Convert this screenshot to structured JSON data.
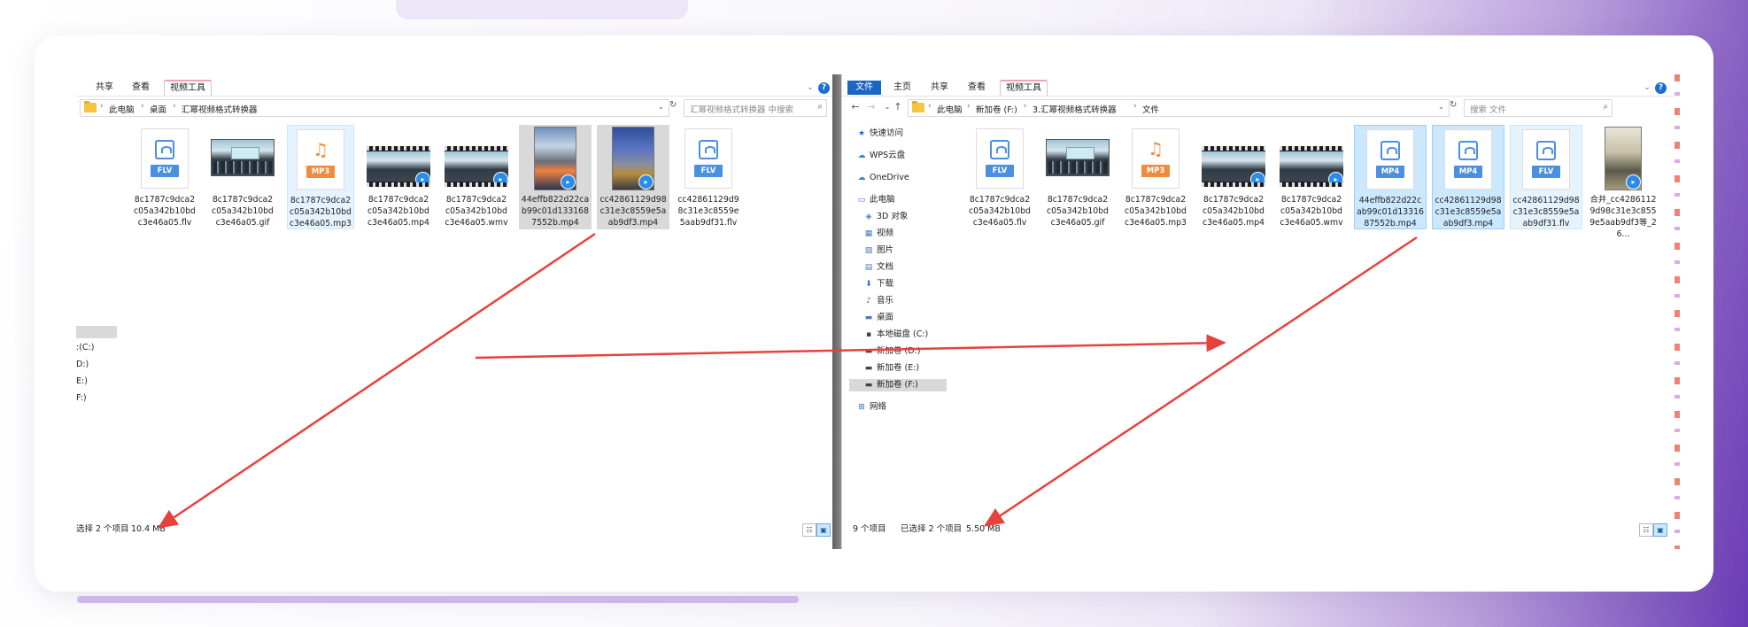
{
  "left_window": {
    "ribbon": {
      "tabs": [
        "共享",
        "查看",
        "视频工具"
      ]
    },
    "breadcrumb": [
      "此电脑",
      "桌面",
      "汇幂视频格式转换器"
    ],
    "search_placeholder": "汇幂视频格式转换器 中搜索",
    "files": [
      {
        "name": "8c1787c9dca2c05a342b10bdc3e46a05.flv",
        "kind": "FLV",
        "state": "normal"
      },
      {
        "name": "8c1787c9dca2c05a342b10bdc3e46a05.gif",
        "kind": "photo",
        "state": "normal"
      },
      {
        "name": "8c1787c9dca2c05a342b10bdc3e46a05.mp3",
        "kind": "MP3",
        "state": "focused"
      },
      {
        "name": "8c1787c9dca2c05a342b10bdc3e46a05.mp4",
        "kind": "film",
        "state": "normal"
      },
      {
        "name": "8c1787c9dca2c05a342b10bdc3e46a05.wmv",
        "kind": "film",
        "state": "normal"
      },
      {
        "name": "44effb822d22cab99c01d1331687552b.mp4",
        "kind": "vertical-a",
        "state": "highlighted"
      },
      {
        "name": "cc42861129d98c31e3c8559e5aab9df3.mp4",
        "kind": "vertical-b",
        "state": "highlighted"
      },
      {
        "name": "cc42861129d98c31e3c8559e5aab9df31.flv",
        "kind": "FLV",
        "state": "normal"
      }
    ],
    "nav_partial": [
      ":(C:)",
      "D:)",
      "E:)",
      "F:)"
    ],
    "status": {
      "selected": "选择 2 个项目",
      "size": "10.4 MB"
    }
  },
  "right_window": {
    "ribbon": {
      "tabs": [
        "文件",
        "主页",
        "共享",
        "查看",
        "视频工具"
      ]
    },
    "breadcrumb": [
      "此电脑",
      "新加卷 (F:)",
      "3.汇幂视频格式转换器",
      "文件"
    ],
    "search_placeholder": "搜索 文件",
    "nav": {
      "quick_access": "快速访问",
      "wps": "WPS云盘",
      "onedrive": "OneDrive",
      "this_pc": "此电脑",
      "items": [
        "3D 对象",
        "视频",
        "图片",
        "文档",
        "下载",
        "音乐",
        "桌面"
      ],
      "drives": [
        "本地磁盘 (C:)",
        "新加卷 (D:)",
        "新加卷 (E:)",
        "新加卷 (F:)"
      ],
      "network": "网络"
    },
    "files": [
      {
        "name": "8c1787c9dca2c05a342b10bdc3e46a05.flv",
        "kind": "FLV",
        "state": "normal"
      },
      {
        "name": "8c1787c9dca2c05a342b10bdc3e46a05.gif",
        "kind": "photo",
        "state": "normal"
      },
      {
        "name": "8c1787c9dca2c05a342b10bdc3e46a05.mp3",
        "kind": "MP3",
        "state": "normal"
      },
      {
        "name": "8c1787c9dca2c05a342b10bdc3e46a05.mp4",
        "kind": "film",
        "state": "normal"
      },
      {
        "name": "8c1787c9dca2c05a342b10bdc3e46a05.wmv",
        "kind": "film",
        "state": "normal"
      },
      {
        "name": "44effb822d22cab99c01d1331687552b.mp4",
        "kind": "MP4",
        "state": "selected"
      },
      {
        "name": "cc42861129d98c31e3c8559e5aab9df3.mp4",
        "kind": "MP4",
        "state": "selected"
      },
      {
        "name": "cc42861129d98c31e3c8559e5aab9df31.flv",
        "kind": "FLV",
        "state": "focused"
      },
      {
        "name": "合并_cc42861129d98c31e3c8559e5aab9df3等_26...",
        "kind": "vertical-c",
        "state": "normal"
      }
    ],
    "status": {
      "count": "9 个项目",
      "selected": "已选择 2 个项目",
      "size": "5.50 MB"
    }
  },
  "icons": {
    "video_badge": "video-badge-icon",
    "help": "help-icon"
  },
  "colors": {
    "accent": "#1a66c2",
    "arrow": "#e8413c",
    "selection": "#cce8ff"
  }
}
